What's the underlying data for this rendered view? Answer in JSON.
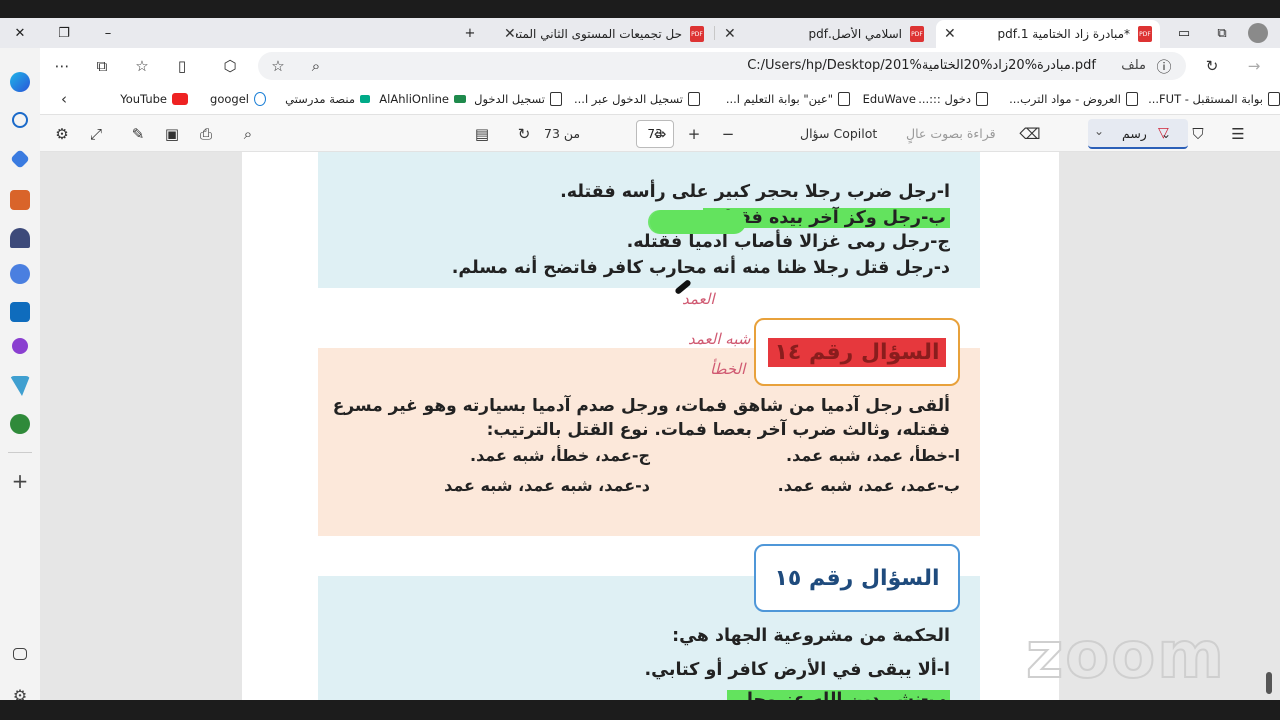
{
  "tabs": [
    {
      "title": "*مبادرة زاد الختامية 1.pdf",
      "active": true
    },
    {
      "title": "اسلامي الأصل.pdf",
      "active": false
    },
    {
      "title": "حل تجميعات المستوى الثاني المتعـ",
      "active": false
    }
  ],
  "address": {
    "url": "C:/Users/hp/Desktop/201%مبادرة%20زاد%20الختامية.pdf",
    "file_label": "ملف"
  },
  "bookmarks": [
    "بوابة المستقبل - FUT...",
    "العروض - مواد الترب...",
    "دخول :::...",
    "EduWave",
    "\"عين\" بوابة التعليم ا...",
    "تسجيل الدخول عبر ا...",
    "تسجيل الدخول",
    "AlAhliOnline",
    "منصة مدرستي",
    "googel",
    "YouTube"
  ],
  "pdf_toolbar": {
    "draw_label": "رسم",
    "read_aloud_label": "قراءة بصوت عالٍ",
    "ask_copilot_label": "سؤال Copilot",
    "page_current": "73",
    "page_of_label": "من 73"
  },
  "doc": {
    "q13_options": [
      "ا-رجل ضرب رجلا بحجر كبير على رأسه فقتله.",
      "ب-رجل وكز آخر بيده فقتله.",
      "ج-رجل رمى غزالا فأصاب آدميا فقتله.",
      "د-رجل قتل رجلا ظنا منه أنه محارب كافر فاتضح أنه مسلم."
    ],
    "q14_title": "السؤال رقم ١٤",
    "q14_stem_1": "ألقى رجل آدميا من شاهق فمات، ورجل صدم آدميا بسيارته وهو غير مسرع",
    "q14_stem_2": "فقتله، وثالث ضرب آخر بعصا فمات. نوع القتل بالترتيب:",
    "q14_opt_a": "ا-خطأ، عمد، شبه عمد.",
    "q14_opt_c": "ج-عمد، خطأ، شبه عمد.",
    "q14_opt_b": "ب-عمد، عمد، شبه عمد.",
    "q14_opt_d": "د-عمد، شبه عمد، شبه عمد",
    "q15_title": "السؤال رقم ١٥",
    "q15_stem": "الحكمة من مشروعية الجهاد هي:",
    "q15_opt_a": "ا-ألا يبقى في الأرض كافر أو كتابي.",
    "q15_opt_b": "ب-نشر دين الله عز وجل.",
    "handwriting": [
      "العمد",
      "شبه العمد",
      "الخطأ"
    ]
  },
  "watermark": "zoom"
}
